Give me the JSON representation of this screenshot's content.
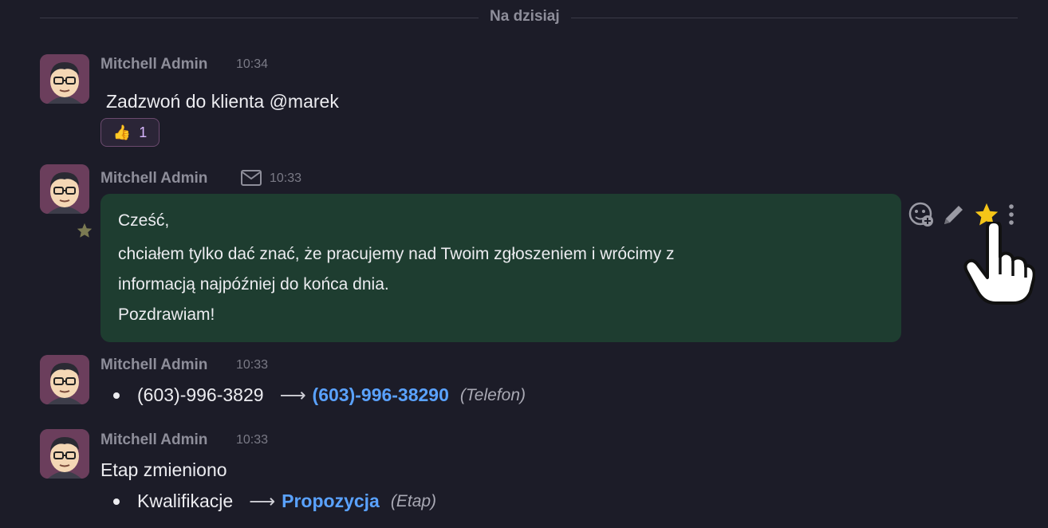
{
  "date_separator": "Na dzisiaj",
  "messages": [
    {
      "author": "Mitchell Admin",
      "time": "10:34",
      "text": "Zadzwoń do klienta @marek",
      "reaction": {
        "emoji": "👍",
        "count": "1"
      }
    },
    {
      "author": "Mitchell Admin",
      "time": "10:33",
      "type_icon": "envelope-icon",
      "lines": [
        "Cześć,",
        "chciałem tylko dać znać, że pracujemy nad Twoim zgłoszeniem i wrócimy z",
        "informacją najpóźniej do końca dnia.",
        "Pozdrawiam!"
      ],
      "starred": true,
      "actions": [
        "add-reaction-icon",
        "edit-pencil-icon",
        "star-icon",
        "more-vertical-icon"
      ]
    },
    {
      "author": "Mitchell Admin",
      "time": "10:33",
      "tracking": {
        "old": "(603)-996-3829",
        "new": "(603)-996-38290",
        "field": "(Telefon)"
      }
    },
    {
      "author": "Mitchell Admin",
      "time": "10:33",
      "text": "Etap zmieniono",
      "tracking": {
        "old": "Kwalifikacje",
        "new": "Propozycja",
        "field": "(Etap)"
      }
    }
  ],
  "colors": {
    "background": "#1c1c28",
    "bubble": "#1e3d30",
    "link": "#5aa2ff",
    "avatar": "#6b3e5c"
  }
}
